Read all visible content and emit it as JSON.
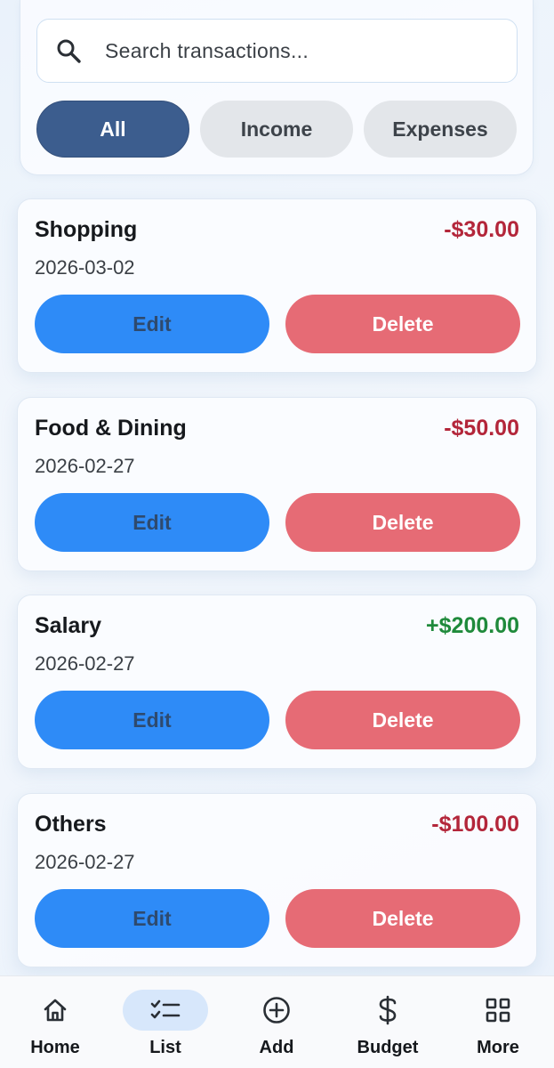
{
  "search": {
    "placeholder": "Search transactions..."
  },
  "filters": [
    {
      "label": "All",
      "active": true
    },
    {
      "label": "Income",
      "active": false
    },
    {
      "label": "Expenses",
      "active": false
    }
  ],
  "transactions": [
    {
      "category": "Shopping",
      "date": "2026-03-02",
      "amount": "-$30.00",
      "type": "expense"
    },
    {
      "category": "Food & Dining",
      "date": "2026-02-27",
      "amount": "-$50.00",
      "type": "expense"
    },
    {
      "category": "Salary",
      "date": "2026-02-27",
      "amount": "+$200.00",
      "type": "income"
    },
    {
      "category": "Others",
      "date": "2026-02-27",
      "amount": "-$100.00",
      "type": "expense"
    }
  ],
  "actions": {
    "edit_label": "Edit",
    "delete_label": "Delete"
  },
  "nav": [
    {
      "label": "Home",
      "icon": "home-icon",
      "active": false
    },
    {
      "label": "List",
      "icon": "list-check-icon",
      "active": true
    },
    {
      "label": "Add",
      "icon": "add-circle-icon",
      "active": false
    },
    {
      "label": "Budget",
      "icon": "dollar-icon",
      "active": false
    },
    {
      "label": "More",
      "icon": "grid-icon",
      "active": false
    }
  ],
  "colors": {
    "active_filter": "#3c5d8e",
    "edit_button": "#2e8bf7",
    "delete_button": "#e66b75",
    "expense_amount": "#b3263a",
    "income_amount": "#1f8a3b",
    "active_nav_pill": "#d7e7fb"
  }
}
